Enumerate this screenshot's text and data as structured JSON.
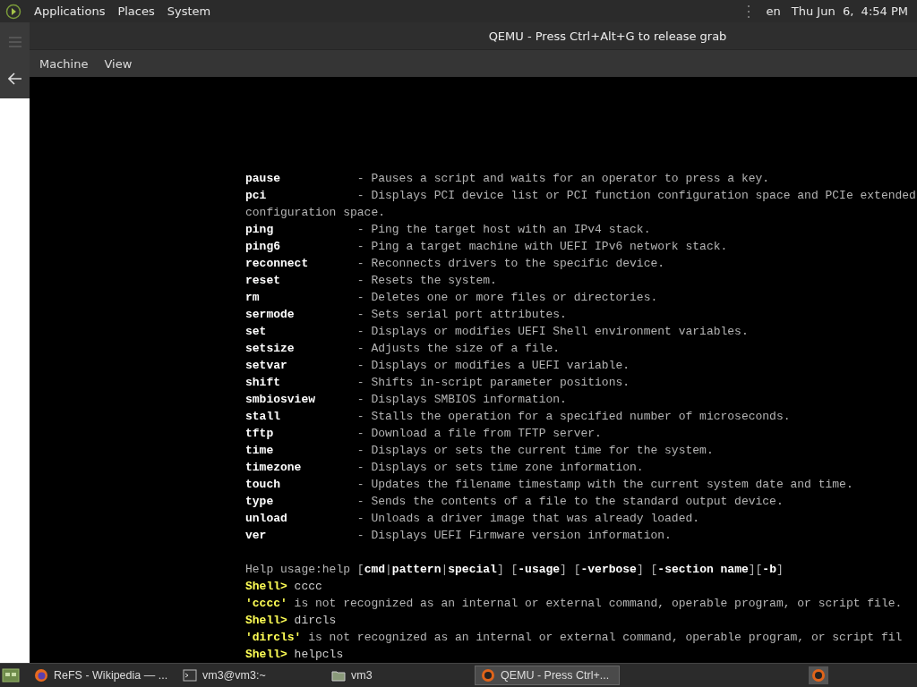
{
  "top_panel": {
    "menus": [
      "Applications",
      "Places",
      "System"
    ],
    "keyboard": "en",
    "clock": "Thu Jun  6,  4:54 PM"
  },
  "window": {
    "title": "QEMU - Press Ctrl+Alt+G to release grab",
    "menus": [
      "Machine",
      "View"
    ]
  },
  "console": {
    "lines": [
      {
        "kind": "command",
        "name": "pause",
        "description": "- Pauses a script and waits for an operator to press a key."
      },
      {
        "kind": "command",
        "name": "pci",
        "description": "- Displays PCI device list or PCI function configuration space and PCIe extended"
      },
      {
        "kind": "wrap",
        "text": "configuration space."
      },
      {
        "kind": "command",
        "name": "ping",
        "description": "- Ping the target host with an IPv4 stack."
      },
      {
        "kind": "command",
        "name": "ping6",
        "description": "- Ping a target machine with UEFI IPv6 network stack."
      },
      {
        "kind": "command",
        "name": "reconnect",
        "description": "- Reconnects drivers to the specific device."
      },
      {
        "kind": "command",
        "name": "reset",
        "description": "- Resets the system."
      },
      {
        "kind": "command",
        "name": "rm",
        "description": "- Deletes one or more files or directories."
      },
      {
        "kind": "command",
        "name": "sermode",
        "description": "- Sets serial port attributes."
      },
      {
        "kind": "command",
        "name": "set",
        "description": "- Displays or modifies UEFI Shell environment variables."
      },
      {
        "kind": "command",
        "name": "setsize",
        "description": "- Adjusts the size of a file."
      },
      {
        "kind": "command",
        "name": "setvar",
        "description": "- Displays or modifies a UEFI variable."
      },
      {
        "kind": "command",
        "name": "shift",
        "description": "- Shifts in-script parameter positions."
      },
      {
        "kind": "command",
        "name": "smbiosview",
        "description": "- Displays SMBIOS information."
      },
      {
        "kind": "command",
        "name": "stall",
        "description": "- Stalls the operation for a specified number of microseconds."
      },
      {
        "kind": "command",
        "name": "tftp",
        "description": "- Download a file from TFTP server."
      },
      {
        "kind": "command",
        "name": "time",
        "description": "- Displays or sets the current time for the system."
      },
      {
        "kind": "command",
        "name": "timezone",
        "description": "- Displays or sets time zone information."
      },
      {
        "kind": "command",
        "name": "touch",
        "description": "- Updates the filename timestamp with the current system date and time."
      },
      {
        "kind": "command",
        "name": "type",
        "description": "- Sends the contents of a file to the standard output device."
      },
      {
        "kind": "command",
        "name": "unload",
        "description": "- Unloads a driver image that was already loaded."
      },
      {
        "kind": "command",
        "name": "ver",
        "description": "- Displays UEFI Firmware version information."
      },
      {
        "kind": "blank"
      },
      {
        "kind": "usage",
        "text": "Help usage:help [**cmd**|**pattern**|**special**] [**-usage**] [**-verbose**] [**-section name**][**-b**]"
      },
      {
        "kind": "prompt",
        "prompt": "Shell>",
        "text": "cccc"
      },
      {
        "kind": "error",
        "token": "'cccc'",
        "text": "is not recognized as an internal or external command, operable program, or script file."
      },
      {
        "kind": "prompt",
        "prompt": "Shell>",
        "text": "dircls"
      },
      {
        "kind": "error",
        "token": "'dircls'",
        "text": "is not recognized as an internal or external command, operable program, or script fil"
      },
      {
        "kind": "prompt",
        "prompt": "Shell>",
        "text": "helpcls"
      }
    ]
  },
  "taskbar": {
    "items": [
      {
        "kind": "browser",
        "label": "ReFS - Wikipedia — ...",
        "selected": false
      },
      {
        "kind": "terminal",
        "label": "vm3@vm3:~",
        "selected": false
      },
      {
        "kind": "folder",
        "label": "vm3",
        "selected": false
      },
      {
        "kind": "qemu",
        "label": "QEMU - Press Ctrl+...",
        "selected": true
      }
    ]
  }
}
